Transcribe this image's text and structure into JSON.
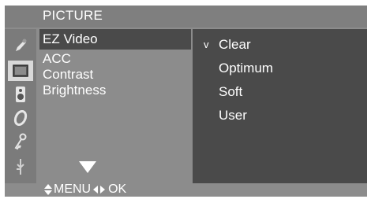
{
  "colors": {
    "panel": "#8c8c8c",
    "selected": "#4a4a4a",
    "icon_active": "#d9d9d9",
    "text": "#ffffff"
  },
  "header": {
    "title": "PICTURE"
  },
  "icons": [
    "tools-icon",
    "picture-icon",
    "speaker-icon",
    "clock-icon",
    "key-icon",
    "input-icon"
  ],
  "menu": {
    "items": [
      "EZ Video",
      "ACC",
      "Contrast",
      "Brightness"
    ],
    "selected_item": "EZ Video"
  },
  "options": {
    "checkmark": "v",
    "items": [
      "Clear",
      "Optimum",
      "Soft",
      "User"
    ],
    "selected_option": "Clear"
  },
  "footer": {
    "menu_label": "MENU",
    "ok_label": "OK"
  }
}
